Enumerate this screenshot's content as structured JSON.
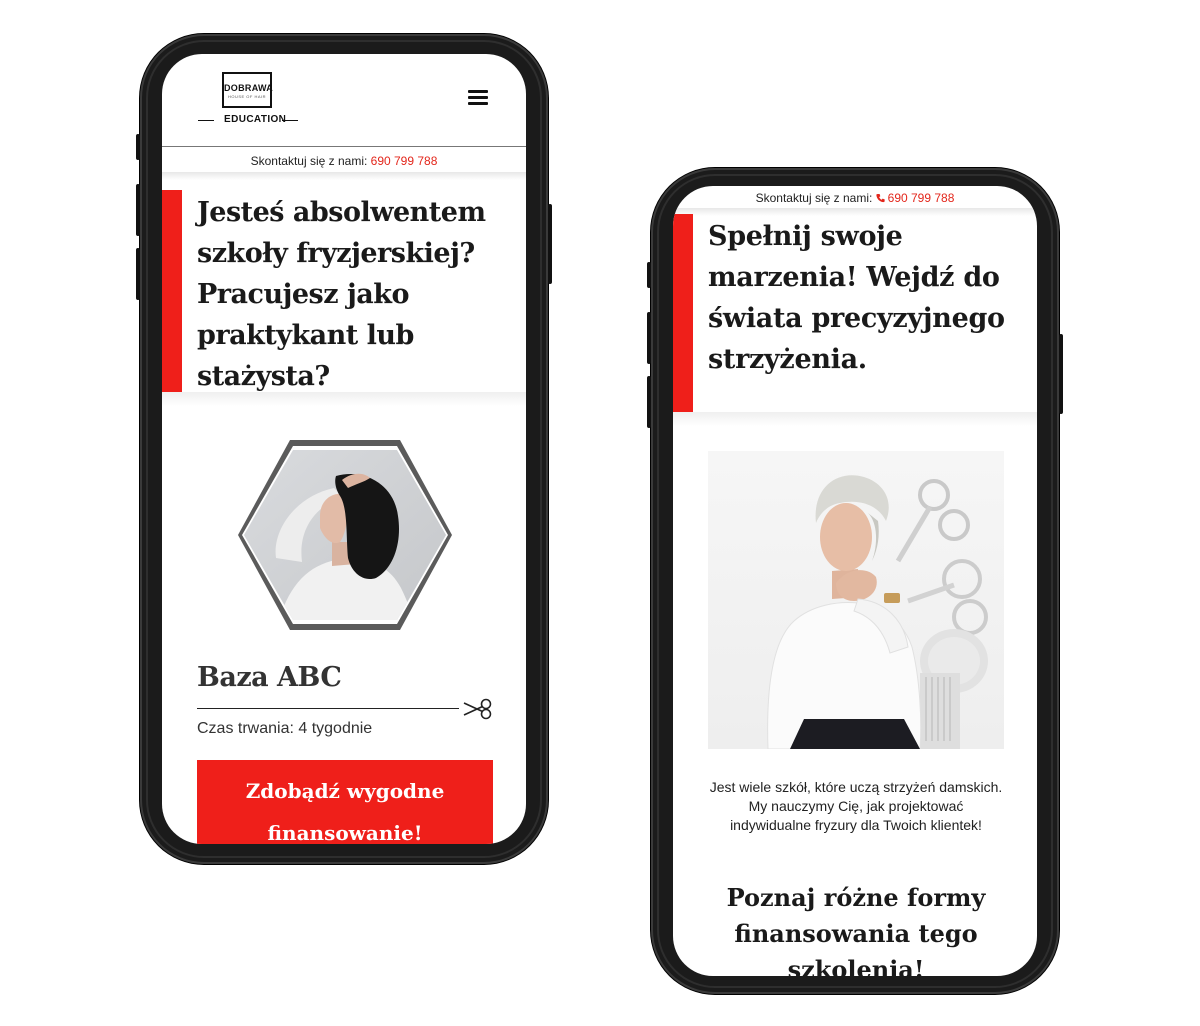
{
  "phone1": {
    "logo": {
      "word": "DOBRAWA",
      "sub": "HOUSE OF HAIR",
      "tagline": "EDUCATION"
    },
    "contact": {
      "label": "Skontaktuj się z nami: ",
      "number": "690 799 788"
    },
    "hero_heading": "Jesteś absolwentem szkoły fryzjerskiej? Pracujesz jako praktykant lub stażysta?",
    "course": {
      "title": "Baza ABC",
      "duration": "Czas trwania: 4 tygodnie"
    },
    "cta_label": "Zdobądź wygodne finansowanie!"
  },
  "phone2": {
    "contact": {
      "label": "Skontaktuj się z nami: ",
      "number": "690 799 788"
    },
    "hero_heading": "Spełnij swoje marzenia! Wejdź do świata precyzyjnego strzyżenia.",
    "paragraph": "Jest wiele szkół, które uczą strzyżeń damskich. My nauczymy Cię, jak projektować indywidualne fryzury dla Twoich klientek!",
    "subheading": "Poznaj różne formy finansowania tego szkolenia!"
  },
  "colors": {
    "accent": "#ef1f1a",
    "text": "#1a1a1a",
    "bezel": "#1b1b1b"
  },
  "icons": [
    "menu-icon",
    "phone-icon",
    "scissors-icon"
  ]
}
